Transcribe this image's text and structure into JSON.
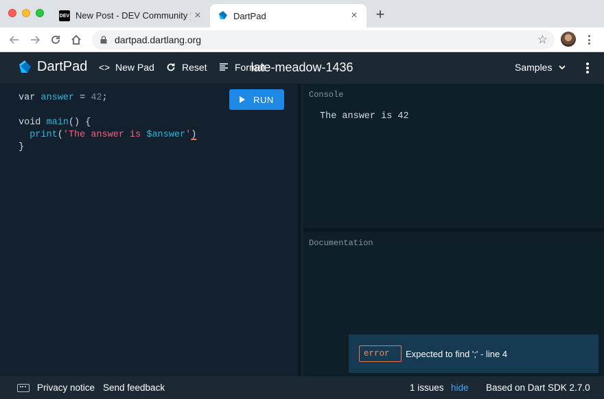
{
  "browser": {
    "tabs": [
      {
        "title": "New Post - DEV Community 👩‍🏭 🕯",
        "favicon_text": "DEV",
        "active": false
      },
      {
        "title": "DartPad",
        "active": true
      }
    ],
    "url": "dartpad.dartlang.org"
  },
  "header": {
    "brand": "DartPad",
    "new_pad": "New Pad",
    "reset": "Reset",
    "format": "Format",
    "pad_name": "late-meadow-1436",
    "samples": "Samples"
  },
  "editor": {
    "run_label": "RUN",
    "lines": [
      {
        "t1": "var ",
        "id": "answer",
        "t2": " = ",
        "num": "42",
        "t3": ";"
      },
      {
        "blank": true
      },
      {
        "t1": "void ",
        "id": "main",
        "t2": "() {"
      },
      {
        "indent": "  ",
        "fn": "print",
        "open": "(",
        "str": "'The answer is ",
        "interp": "$answer",
        "strend": "'",
        "close": ")"
      },
      {
        "t1": "}"
      }
    ]
  },
  "console": {
    "label": "Console",
    "output": "The answer is 42"
  },
  "docs": {
    "label": "Documentation"
  },
  "issue": {
    "badge": "error",
    "message": "Expected to find ';' - line 4"
  },
  "footer": {
    "privacy": "Privacy notice",
    "feedback": "Send feedback",
    "issues": "1 issues",
    "hide": "hide",
    "sdk": "Based on Dart SDK 2.7.0"
  },
  "colors": {
    "header_bg": "#1c2834",
    "editor_bg": "#12212d",
    "run_button": "#1e88e5",
    "identifier": "#2fb3d9",
    "string": "#f2607a",
    "error": "#f08c5a",
    "link": "#42a5f5"
  }
}
